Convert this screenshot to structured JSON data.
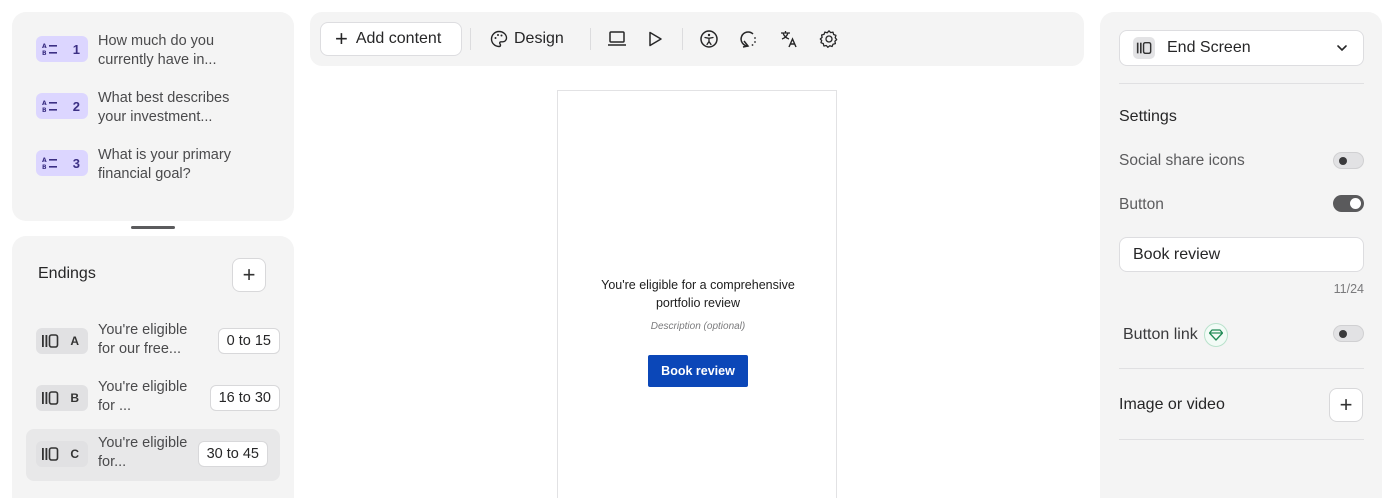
{
  "questions": [
    {
      "number": "1",
      "text": "How much do you currently have in..."
    },
    {
      "number": "2",
      "text": "What best describes your investment..."
    },
    {
      "number": "3",
      "text": "What is your primary financial goal?"
    }
  ],
  "endings": {
    "title": "Endings",
    "items": [
      {
        "letter": "A",
        "text": "You're eligible for our free...",
        "range": "0 to 15"
      },
      {
        "letter": "B",
        "text": "You're eligible for ...",
        "range": "16 to 30"
      },
      {
        "letter": "C",
        "text": "You're eligible for...",
        "range": "30 to 45"
      }
    ]
  },
  "toolbar": {
    "add_content_label": "Add content",
    "design_label": "Design"
  },
  "preview": {
    "title": "You're eligible for a comprehensive portfolio review",
    "description": "Description (optional)",
    "button_label": "Book review"
  },
  "right_panel": {
    "screen_select": "End Screen",
    "settings_title": "Settings",
    "social_share_label": "Social share icons",
    "social_share_on": false,
    "button_label": "Button",
    "button_on": true,
    "button_text_value": "Book review",
    "char_count": "11/24",
    "button_link_label": "Button link",
    "button_link_on": false,
    "image_video_label": "Image or video"
  },
  "colors": {
    "question_badge": "#dcd6ff",
    "preview_button": "#0b47b8",
    "panel_bg": "#f4f4f4"
  }
}
